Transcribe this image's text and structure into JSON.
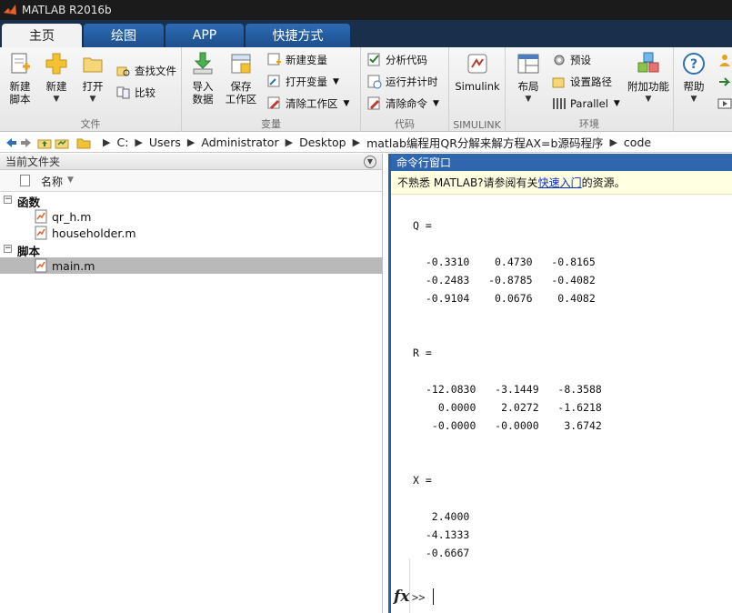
{
  "window": {
    "title": "MATLAB R2016b"
  },
  "tabs": [
    {
      "label": "主页"
    },
    {
      "label": "绘图"
    },
    {
      "label": "APP"
    },
    {
      "label": "快捷方式"
    }
  ],
  "ribbon": {
    "file": {
      "section_label": "文件",
      "new_script_l1": "新建",
      "new_script_l2": "脚本",
      "new_label": "新建",
      "open_label": "打开",
      "find_files": "查找文件",
      "compare": "比较"
    },
    "variable": {
      "section_label": "变量",
      "import_l1": "导入",
      "import_l2": "数据",
      "save_ws_l1": "保存",
      "save_ws_l2": "工作区",
      "new_variable": "新建变量",
      "open_variable": "打开变量",
      "clear_workspace": "清除工作区"
    },
    "code": {
      "section_label": "代码",
      "analyze_code": "分析代码",
      "run_and_time": "运行并计时",
      "clear_commands": "清除命令"
    },
    "simulink": {
      "section_label": "SIMULINK",
      "simulink_label": "Simulink"
    },
    "environment": {
      "section_label": "环境",
      "layout_label": "布局",
      "preferences": "预设",
      "set_path": "设置路径",
      "parallel": "Parallel",
      "addons_label": "附加功能"
    },
    "resources": {
      "help_label": "帮助"
    }
  },
  "address_bar": {
    "path": [
      "C:",
      "Users",
      "Administrator",
      "Desktop",
      "matlab编程用QR分解来解方程AX=b源码程序",
      "code"
    ]
  },
  "current_folder": {
    "title": "当前文件夹",
    "column_name": "名称",
    "groups": [
      {
        "label": "函数",
        "files": [
          "qr_h.m",
          "householder.m"
        ]
      },
      {
        "label": "脚本",
        "files": [
          "main.m"
        ]
      }
    ],
    "selected_file": "main.m"
  },
  "command_window": {
    "title": "命令行窗口",
    "notice_prefix": "不熟悉 MATLAB?请参阅有关",
    "notice_link": "快速入门",
    "notice_suffix": "的资源。",
    "output": [
      {
        "label": "Q =",
        "rows": [
          "  -0.3310    0.4730   -0.8165",
          "  -0.2483   -0.8785   -0.4082",
          "  -0.9104    0.0676    0.4082"
        ]
      },
      {
        "label": "R =",
        "rows": [
          "-12.0830   -3.1449   -8.3588",
          "  0.0000    2.0272   -1.6218",
          " -0.0000   -0.0000    3.6742"
        ]
      },
      {
        "label": "X =",
        "rows": [
          "   2.4000",
          "  -4.1333",
          "  -0.6667"
        ]
      }
    ],
    "prompt_symbol": ">>",
    "fx_label": "fx"
  },
  "colors": {
    "tab_bar": "#1a2f4c",
    "tab_inactive": "#2d6bb4",
    "command_header": "#2f66ad",
    "selected_row": "#b9b9b9",
    "notice_bg": "#ffffe1"
  }
}
